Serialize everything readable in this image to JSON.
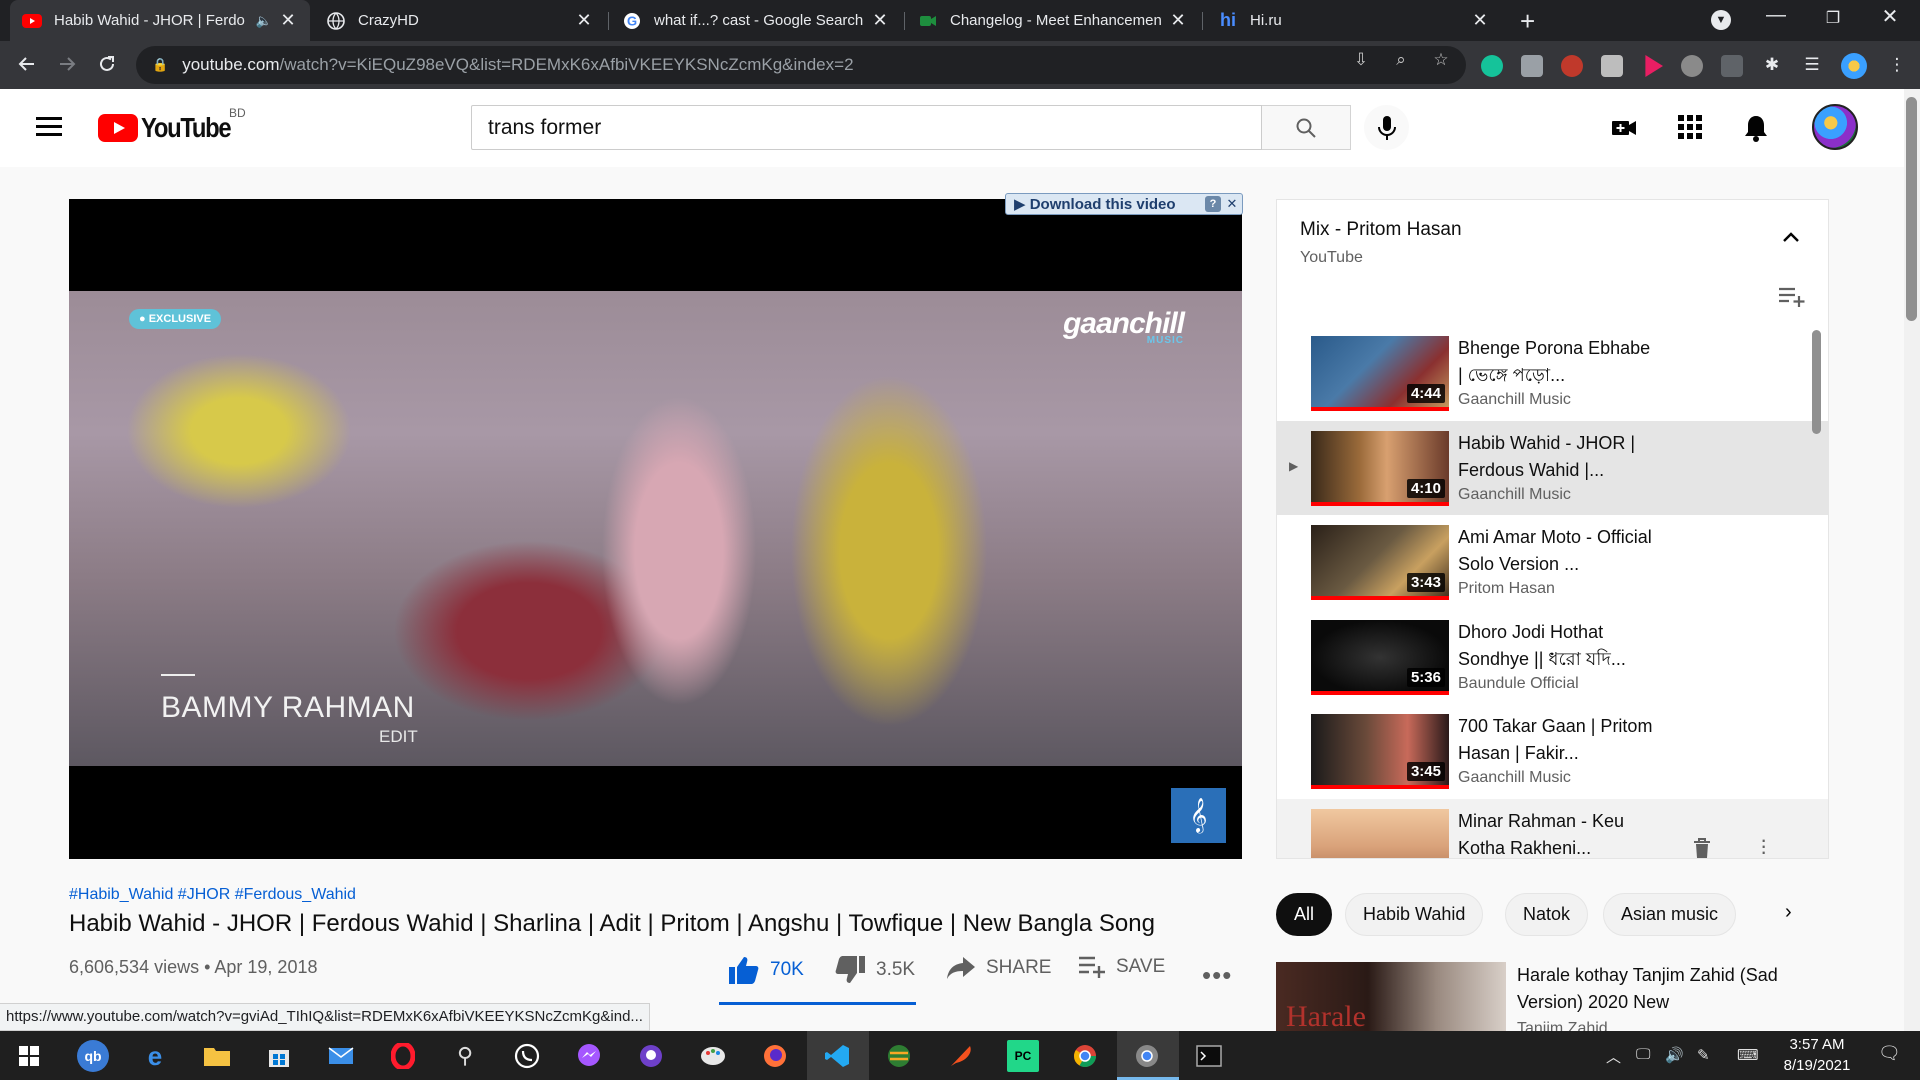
{
  "browser": {
    "tabs": [
      {
        "title": "Habib Wahid - JHOR | Ferdo",
        "favicon": "youtube-icon",
        "active": true,
        "audio": true
      },
      {
        "title": "CrazyHD",
        "favicon": "globe-icon",
        "active": false
      },
      {
        "title": "what if...? cast - Google Search",
        "favicon": "google-icon",
        "active": false
      },
      {
        "title": "Changelog - Meet Enhancement",
        "favicon": "meet-icon",
        "active": false
      },
      {
        "title": "Hi.ru",
        "favicon": "hi-icon",
        "active": false
      }
    ],
    "url_host": "youtube.com",
    "url_rest": "/watch?v=KiEQuZ98eVQ&list=RDEMxK6xAfbiVKEEYKSNcZcmKg&index=2"
  },
  "masthead": {
    "logo_text": "YouTube",
    "country_code": "BD",
    "search_value": "trans former"
  },
  "player": {
    "download_bar_label": "▶ Download this video",
    "download_help": "?",
    "download_close": "✕",
    "badge_text": "● EXCLUSIVE",
    "channel_logo_text": "gaanchill",
    "channel_logo_sub": "MUSIC",
    "credit_name": "BAMMY RAHMAN",
    "credit_role": "EDIT"
  },
  "video": {
    "hashtags": "#Habib_Wahid #JHOR #Ferdous_Wahid",
    "title": "Habib Wahid - JHOR | Ferdous Wahid | Sharlina | Adit | Pritom | Angshu | Towfique | New Bangla Song",
    "meta": "6,606,534 views • Apr 19, 2018",
    "likes": "70K",
    "dislikes": "3.5K",
    "share_label": "SHARE",
    "save_label": "SAVE",
    "more_label": "•••"
  },
  "playlist": {
    "title": "Mix - Pritom Hasan",
    "owner": "YouTube",
    "items": [
      {
        "title": "Bhenge Porona Ebhabe | ভেঙ্গে পড়ো...",
        "channel": "Gaanchill Music",
        "duration": "4:44",
        "progress": 1.0,
        "thumb_color": "#2a5a8a",
        "current": false
      },
      {
        "title": "Habib Wahid - JHOR | Ferdous Wahid |...",
        "channel": "Gaanchill Music",
        "duration": "4:10",
        "progress": 1.0,
        "thumb_color": "#6a4a2a",
        "current": true,
        "indicator": "▶"
      },
      {
        "title": "Ami Amar Moto - Official Solo Version ...",
        "channel": "Pritom Hasan",
        "duration": "3:43",
        "progress": 1.0,
        "thumb_color": "#5a4a32",
        "current": false
      },
      {
        "title": "Dhoro Jodi Hothat Sondhye || ধরো যদি...",
        "channel": "Baundule Official",
        "duration": "5:36",
        "progress": 1.0,
        "thumb_color": "#111111",
        "current": false
      },
      {
        "title": "700 Takar Gaan | Pritom Hasan | Fakir...",
        "channel": "Gaanchill Music",
        "duration": "3:45",
        "progress": 1.0,
        "thumb_color": "#3a2a22",
        "current": false
      },
      {
        "title": "Minar Rahman - Keu Kotha Rakheni...",
        "channel": "",
        "duration": "",
        "progress": 0,
        "thumb_color": "#d9a27a",
        "current": false,
        "hovered": true
      }
    ]
  },
  "chips": [
    "All",
    "Habib Wahid",
    "Natok",
    "Asian music"
  ],
  "chip_next": "›",
  "related": {
    "thumb_text": "Harale",
    "title": "Harale kothay Tanjim Zahid (Sad Version) 2020 New",
    "channel": "Tanjim Zahid"
  },
  "status_url": "https://www.youtube.com/watch?v=gviAd_TIhIQ&list=RDEMxK6xAfbiVKEEYKSNcZcmKg&ind...",
  "taskbar": {
    "time": "3:57 AM",
    "date": "8/19/2021"
  }
}
